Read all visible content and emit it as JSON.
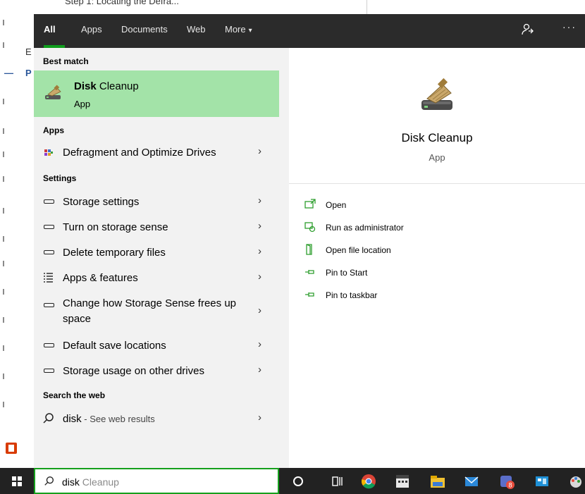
{
  "background_doc": {
    "top_text": "Step 1: Locating the Defra...",
    "side_letter_1": "E",
    "side_letter_2": "P",
    "bullet": "—"
  },
  "nav": {
    "tabs": [
      {
        "label": "All",
        "active": true
      },
      {
        "label": "Apps"
      },
      {
        "label": "Documents"
      },
      {
        "label": "Web"
      },
      {
        "label": "More"
      }
    ],
    "more_caret": "▾",
    "feedback_icon": "feedback-icon",
    "more_options": "···",
    "accent": "#0f9d1c"
  },
  "left": {
    "best_match_heading": "Best match",
    "best_match": {
      "name_bold": "Disk",
      "name_rest": " Cleanup",
      "type": "App",
      "bg": "#a3e3a8"
    },
    "apps_heading": "Apps",
    "apps": [
      {
        "label": "Defragment and Optimize Drives",
        "icon": "defrag-icon"
      }
    ],
    "settings_heading": "Settings",
    "settings": [
      {
        "label": "Storage settings",
        "icon": "drive-icon"
      },
      {
        "label": "Turn on storage sense",
        "icon": "drive-icon"
      },
      {
        "label": "Delete temporary files",
        "icon": "drive-icon"
      },
      {
        "label": "Apps & features",
        "icon": "list-icon"
      },
      {
        "label": "Change how Storage Sense frees up space",
        "icon": "drive-icon"
      },
      {
        "label": "Default save locations",
        "icon": "drive-icon"
      },
      {
        "label": "Storage usage on other drives",
        "icon": "drive-icon"
      }
    ],
    "web_heading": "Search the web",
    "web_query": "disk",
    "web_suffix": " - See web results",
    "chevron": "›"
  },
  "right": {
    "title": "Disk Cleanup",
    "subtitle": "App",
    "actions": [
      {
        "label": "Open",
        "icon": "open-icon"
      },
      {
        "label": "Run as administrator",
        "icon": "shield-icon"
      },
      {
        "label": "Open file location",
        "icon": "folder-icon"
      },
      {
        "label": "Pin to Start",
        "icon": "pin-icon"
      },
      {
        "label": "Pin to taskbar",
        "icon": "pin-icon"
      }
    ]
  },
  "taskbar": {
    "search_typed": "disk",
    "search_suggestion": " Cleanup",
    "search_border": "#16a01d",
    "badge_count": "8"
  }
}
